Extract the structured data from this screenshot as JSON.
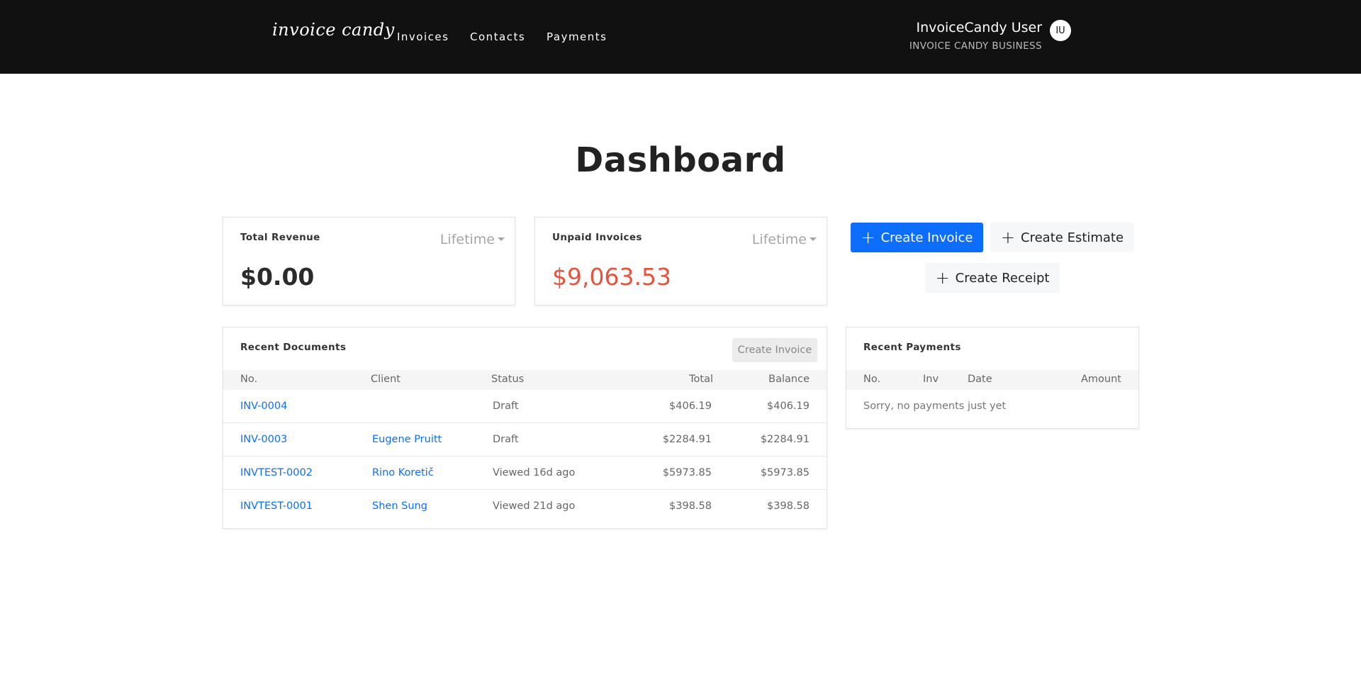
{
  "nav": {
    "logo": "invoice candy",
    "links": [
      "Invoices",
      "Contacts",
      "Payments"
    ],
    "user_name": "InvoiceCandy User",
    "business": "INVOICE CANDY BUSINESS",
    "avatar_initials": "IU"
  },
  "page": {
    "title": "Dashboard"
  },
  "revenue": {
    "title": "Total Revenue",
    "period": "Lifetime",
    "amount": "$0.00",
    "color": "#2b2b2b"
  },
  "unpaid": {
    "title": "Unpaid Invoices",
    "period": "Lifetime",
    "amount": "$9,063.53",
    "color": "#e5533c"
  },
  "actions": {
    "create_invoice": "Create Invoice",
    "create_estimate": "Create Estimate",
    "create_receipt": "Create Receipt",
    "primary_color": "#0d6efd"
  },
  "recent_documents": {
    "title": "Recent Documents",
    "button": "Create Invoice",
    "columns": [
      "No.",
      "Client",
      "Status",
      "Total",
      "Balance"
    ],
    "rows": [
      {
        "no": "INV-0004",
        "client": "",
        "status": "Draft",
        "total": "$406.19",
        "balance": "$406.19"
      },
      {
        "no": "INV-0003",
        "client": "Eugene Pruitt",
        "status": "Draft",
        "total": "$2284.91",
        "balance": "$2284.91"
      },
      {
        "no": "INVTEST-0002",
        "client": "Rino Koretič",
        "status": "Viewed 16d ago",
        "total": "$5973.85",
        "balance": "$5973.85"
      },
      {
        "no": "INVTEST-0001",
        "client": "Shen Sung",
        "status": "Viewed 21d ago",
        "total": "$398.58",
        "balance": "$398.58"
      }
    ]
  },
  "recent_payments": {
    "title": "Recent Payments",
    "columns": [
      "No.",
      "Inv",
      "Date",
      "Amount"
    ],
    "empty": "Sorry, no payments just yet"
  }
}
